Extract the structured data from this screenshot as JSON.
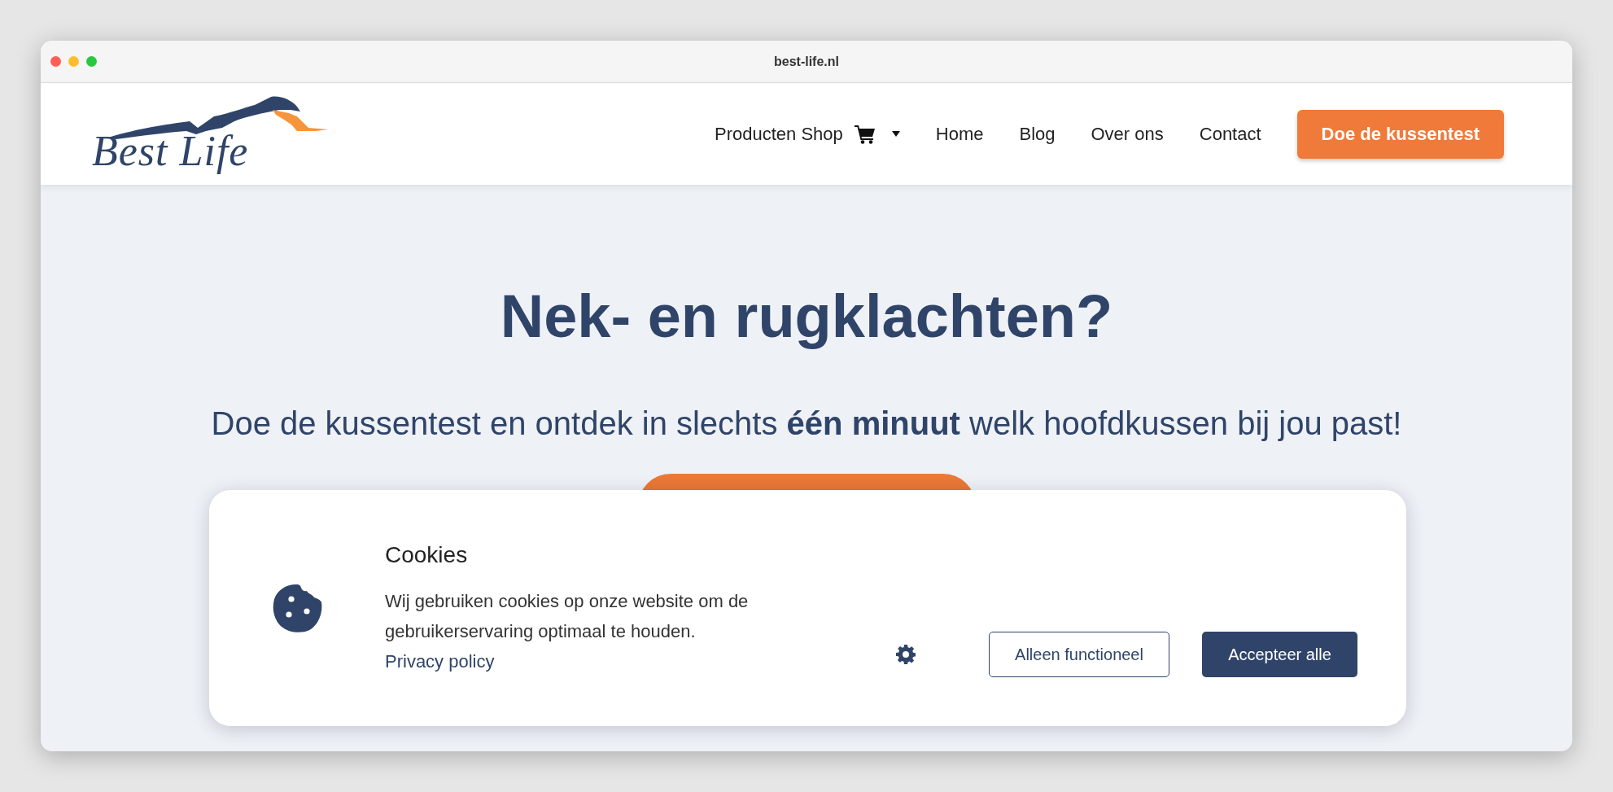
{
  "window": {
    "title": "best-life.nl"
  },
  "header": {
    "logo": "Best Life",
    "nav": [
      {
        "label": "Producten Shop",
        "kind": "shop"
      },
      {
        "label": "Home",
        "kind": "link"
      },
      {
        "label": "Blog",
        "kind": "link"
      },
      {
        "label": "Over ons",
        "kind": "link"
      },
      {
        "label": "Contact",
        "kind": "link"
      }
    ],
    "cta": "Doe de kussentest"
  },
  "hero": {
    "title": "Nek- en rugklachten?",
    "subtitle": "Doe de kussentest en ontdek in slechts **één minuut** welk hoofdkussen bij jou past!"
  },
  "cookie_banner": {
    "title": "Cookies",
    "text": "Wij gebruiken cookies op onze website om de gebruikerservaring optimaal te houden.",
    "link": "Privacy policy",
    "buttons": [
      {
        "label": "Alleen functioneel",
        "kind": "outline"
      },
      {
        "label": "Accepteer alle",
        "kind": "primary"
      }
    ]
  }
}
